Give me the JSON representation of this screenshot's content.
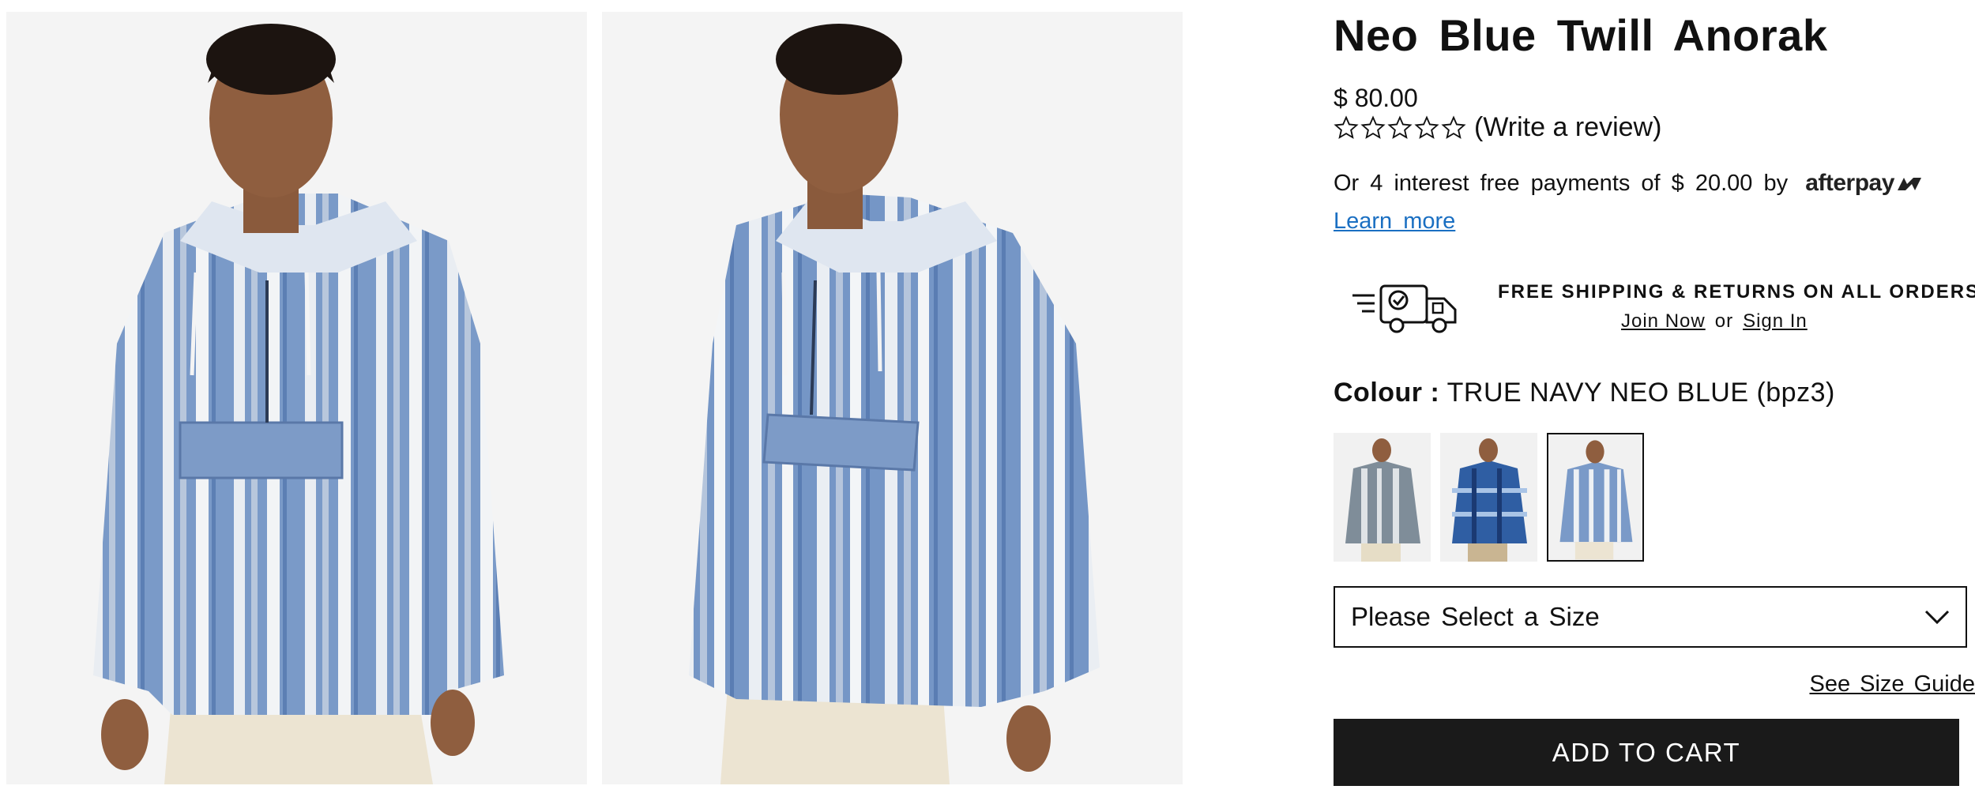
{
  "product": {
    "title": "Neo Blue Twill Anorak",
    "price": "$ 80.00",
    "rating": {
      "stars_filled": 0,
      "stars_total": 5,
      "review_link": "(Write a review)"
    },
    "afterpay": {
      "text_before": "Or 4 interest free payments of $ 20.00 by",
      "logo_text": "afterpay",
      "learn_more": "Learn more"
    },
    "shipping": {
      "headline": "FREE SHIPPING & RETURNS ON ALL ORDERS",
      "join_label": "Join Now",
      "or_label": "or",
      "signin_label": "Sign In"
    },
    "colour": {
      "label": "Colour :",
      "value": "TRUE NAVY NEO BLUE (bpz3)"
    },
    "swatches": [
      {
        "name": "striped-grey-variant",
        "selected": false
      },
      {
        "name": "blue-plaid-variant",
        "selected": false
      },
      {
        "name": "neo-blue-stripe-variant",
        "selected": true
      }
    ],
    "size_select": {
      "placeholder": "Please Select a Size"
    },
    "size_guide": "See Size Guide",
    "add_to_cart": "ADD TO CART"
  },
  "colors": {
    "accent_link": "#1a6fc2",
    "button_bg": "#1a1a1a",
    "photo_bg": "#f4f4f4"
  },
  "icons": [
    "star-outline-icon",
    "afterpay-logo-icon",
    "delivery-truck-icon",
    "chevron-down-icon"
  ]
}
